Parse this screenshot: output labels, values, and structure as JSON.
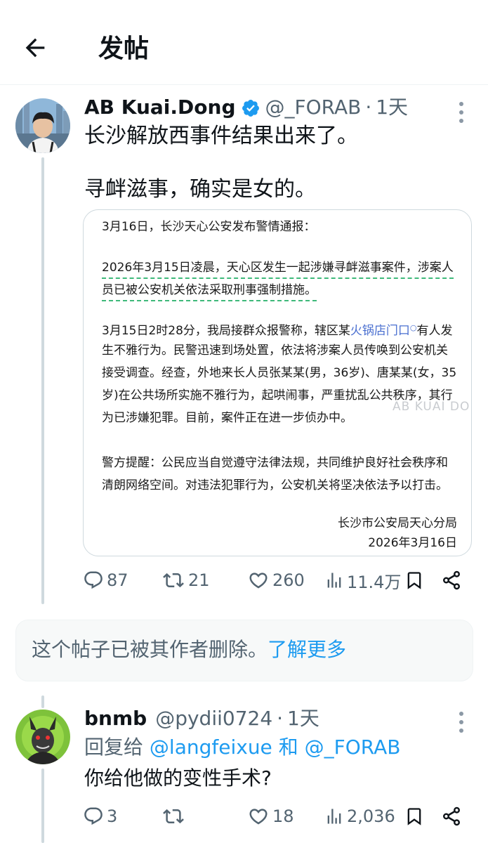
{
  "header": {
    "title": "发帖"
  },
  "post": {
    "display_name": "AB Kuai.Dong",
    "handle": "@_FORAB",
    "separator": "·",
    "time": "1天",
    "lines": [
      "长沙解放西事件结果出来了。",
      "寻衅滋事，确实是女的。"
    ],
    "card": {
      "line1": "3月16日，长沙天心公安发布警情通报：",
      "para1": [
        "2026年3月15日凌晨，天心区发生一起涉嫌寻衅滋事案件，涉案人",
        "员已被公安机关依法采取刑事强制措施。"
      ],
      "para2_l1_a": "3月15日2时28分，我局接群众报警称，辖区某",
      "para2_l1_link": "火锅店门口",
      "para2_l1_b": "有人发",
      "para2_rest": [
        "生不雅行为。民警迅速到场处置，依法将涉案人员传唤到公安机关",
        "接受调查。经查，外地来长人员张某某(男，36岁)、唐某某(女，35",
        "岁)在公共场所实施不雅行为，起哄闹事，严重扰乱公共秩序，其行",
        "为已涉嫌犯罪。目前，案件正在进一步侦办中。"
      ],
      "para3": [
        "警方提醒：公民应当自觉遵守法律法规，共同维护良好社会秩序和",
        "清朗网络空间。对违法犯罪行为，公安机关将坚决依法予以打击。"
      ],
      "signature": "长沙市公安局天心分局",
      "date": "2026年3月16日",
      "watermark": "AB KUAI DONG"
    },
    "stats": {
      "replies": "87",
      "reposts": "21",
      "likes": "260",
      "views": "11.4万"
    }
  },
  "deleted_notice": {
    "text": "这个帖子已被其作者删除。",
    "link": "了解更多"
  },
  "reply": {
    "display_name": "bnmb",
    "handle": "@pydii0724",
    "separator": "·",
    "time": "1天",
    "reply_prefix": "回复给",
    "mention1": "@langfeixue",
    "conj": "和",
    "mention2": "@_FORAB",
    "text": "你给他做的变性手术?",
    "stats": {
      "replies": "3",
      "reposts": "",
      "likes": "18",
      "views": "2,036"
    }
  },
  "colors": {
    "accent": "#1d9bf0",
    "secondary_text": "#536471",
    "divider": "#cfd9de"
  }
}
